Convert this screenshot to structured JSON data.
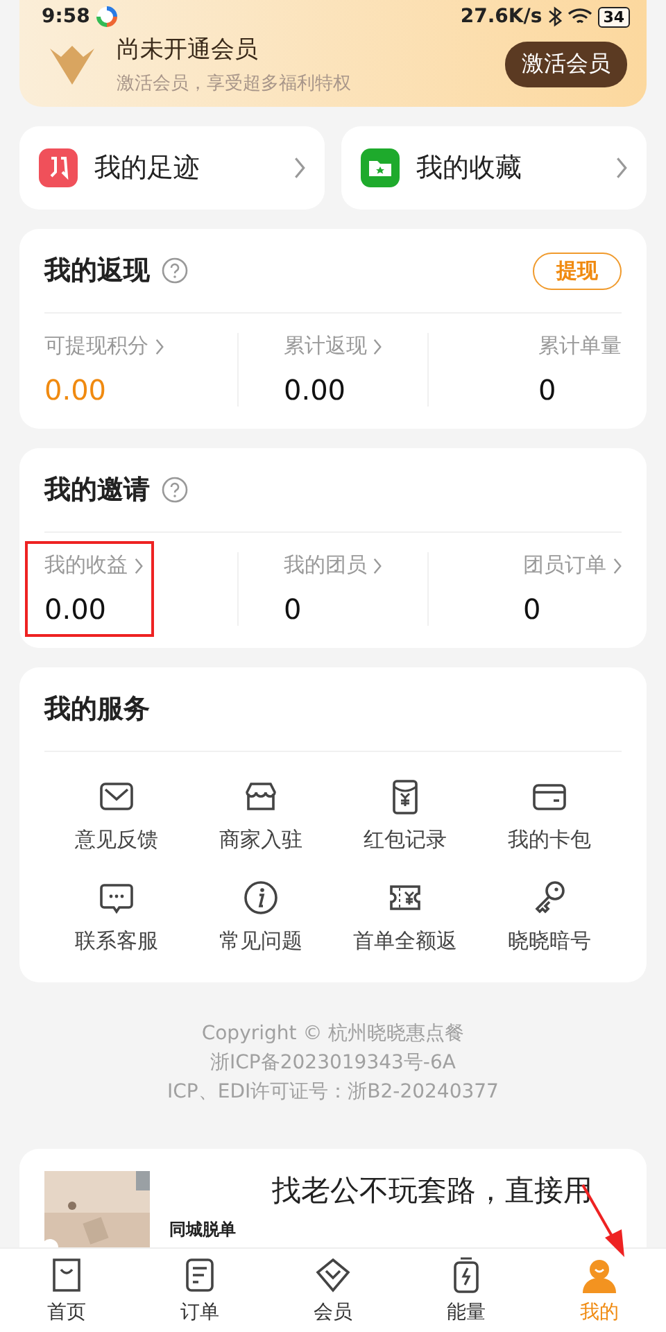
{
  "status_bar": {
    "time": "9:58",
    "speed": "27.6K/s",
    "battery": "34"
  },
  "member_banner": {
    "title": "尚未开通会员",
    "subtitle": "激活会员，享受超多福利特权",
    "button": "激活会员"
  },
  "shortcuts": [
    {
      "kind": "footprint",
      "label": "我的足迹"
    },
    {
      "kind": "favorites",
      "label": "我的收藏"
    }
  ],
  "cashback": {
    "title": "我的返现",
    "button": "提现",
    "stats": [
      {
        "label": "可提现积分",
        "value": "0.00",
        "arrow": true,
        "accent": true,
        "highlighted": false
      },
      {
        "label": "累计返现",
        "value": "0.00",
        "arrow": true,
        "accent": false,
        "highlighted": false
      },
      {
        "label": "累计单量",
        "value": "0",
        "arrow": false,
        "accent": false,
        "highlighted": false
      }
    ]
  },
  "invite": {
    "title": "我的邀请",
    "stats": [
      {
        "label": "我的收益",
        "value": "0.00",
        "arrow": true,
        "accent": false,
        "highlighted": true
      },
      {
        "label": "我的团员",
        "value": "0",
        "arrow": true,
        "accent": false,
        "highlighted": false
      },
      {
        "label": "团员订单",
        "value": "0",
        "arrow": true,
        "accent": false,
        "highlighted": false
      }
    ]
  },
  "services": {
    "title": "我的服务",
    "items": [
      {
        "kind": "mail",
        "label": "意见反馈"
      },
      {
        "kind": "shop",
        "label": "商家入驻"
      },
      {
        "kind": "redpacket",
        "label": "红包记录"
      },
      {
        "kind": "card",
        "label": "我的卡包"
      },
      {
        "kind": "chat",
        "label": "联系客服"
      },
      {
        "kind": "info",
        "label": "常见问题"
      },
      {
        "kind": "ticket",
        "label": "首单全额返"
      },
      {
        "kind": "key",
        "label": "晓晓暗号"
      }
    ]
  },
  "footer": [
    "Copyright © 杭州晓晓惠点餐",
    "浙ICP备2023019343号-6A",
    "ICP、EDI许可证号：浙B2-20240377"
  ],
  "ad": {
    "kind": "picture",
    "caption": "同城脱单",
    "headline": "找老公不玩套路，直接用"
  },
  "tabs": [
    {
      "kind": "home",
      "label": "首页",
      "selected": false,
      "pointed": false
    },
    {
      "kind": "orders",
      "label": "订单",
      "selected": false,
      "pointed": false
    },
    {
      "kind": "member",
      "label": "会员",
      "selected": false,
      "pointed": false
    },
    {
      "kind": "energy",
      "label": "能量",
      "selected": false,
      "pointed": false
    },
    {
      "kind": "me",
      "label": "我的",
      "selected": true,
      "pointed": true
    }
  ]
}
